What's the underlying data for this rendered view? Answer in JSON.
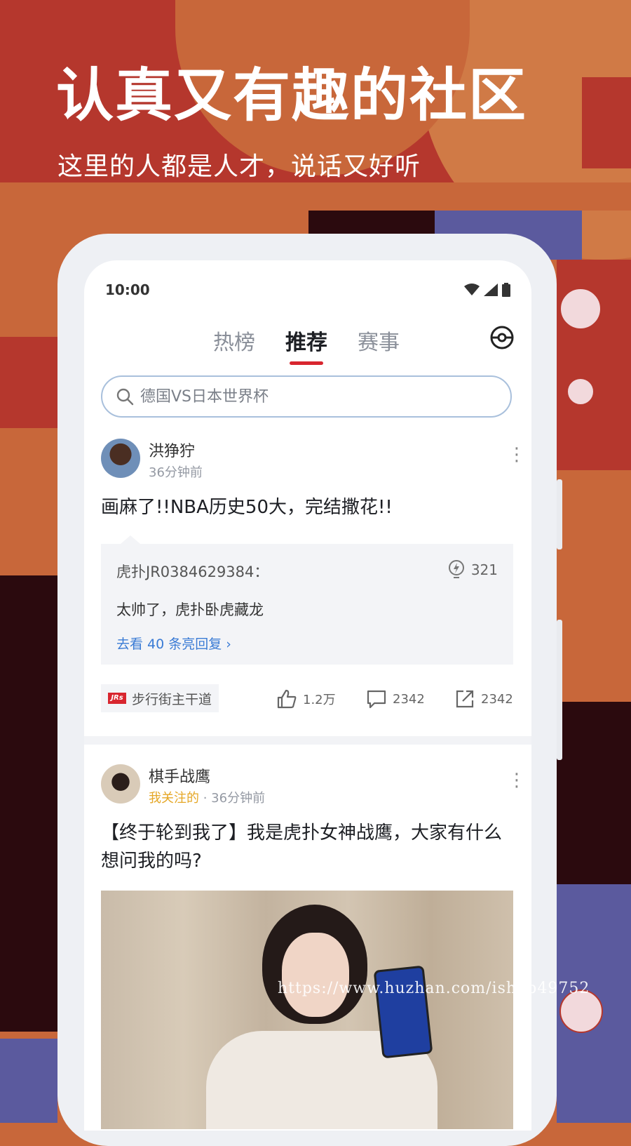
{
  "promo": {
    "headline": "认真又有趣的社区",
    "subline": "这里的人都是人才，说话又好听"
  },
  "colors": {
    "accent": "#d8262f",
    "background": "#c8673a",
    "link": "#3a7bd5",
    "followed": "#e5a726"
  },
  "status_bar": {
    "time": "10:00",
    "icons": [
      "wifi-icon",
      "signal-icon",
      "battery-icon"
    ]
  },
  "tabs": [
    {
      "label": "热榜",
      "active": false
    },
    {
      "label": "推荐",
      "active": true
    },
    {
      "label": "赛事",
      "active": false
    }
  ],
  "header_icon": "target-icon",
  "search": {
    "placeholder": "德国VS日本世界杯"
  },
  "posts": [
    {
      "author": "洪狰狞",
      "time": "36分钟前",
      "title": "画麻了!!NBA历史50大，完结撒花!!",
      "hot_reply": {
        "user": "虎扑JR0384629384：",
        "lights": "321",
        "text": "太帅了，虎扑卧虎藏龙",
        "link": "去看 40 条亮回复 ›"
      },
      "forum": {
        "logo": "JRs",
        "name": "步行街主干道"
      },
      "likes": "1.2万",
      "comments": "2342",
      "shares": "2342"
    },
    {
      "author": "棋手战鹰",
      "followed_label": "我关注的",
      "time": "· 36分钟前",
      "title": "【终于轮到我了】我是虎扑女神战鹰，大家有什么想问我的吗?"
    }
  ],
  "watermark": "https://www.huzhan.com/ishop49752"
}
